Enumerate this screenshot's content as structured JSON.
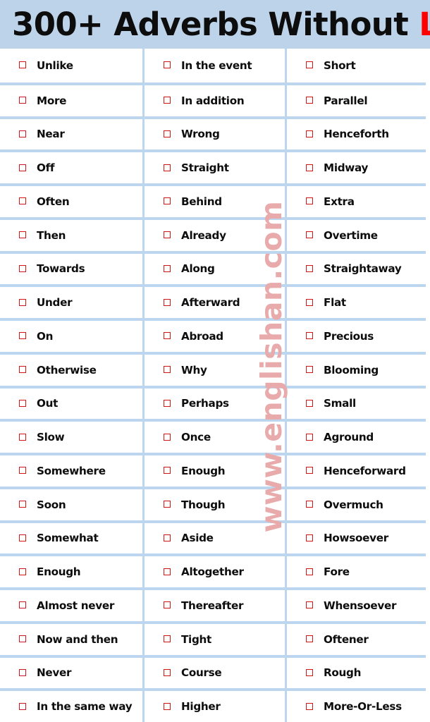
{
  "header": {
    "title_main": "300+ Adverbs Without ",
    "title_accent": "LY",
    "background_color": "#bdd3e9",
    "text_color": "#0d0d0d",
    "accent_color": "#ff0000"
  },
  "watermark": {
    "text": "www.englishan.com",
    "color": "#e8aaaa",
    "rotation": "-90deg"
  },
  "table": {
    "checkbox_icon": "empty-checkbox-icon",
    "checkbox_color": "#cf1717",
    "divider_color": "#bcd6ef",
    "row_count": 20,
    "column_count": 3,
    "columns": [
      {
        "name": "column-1",
        "items": [
          "Unlike",
          "More",
          "Near",
          "Off",
          "Often",
          "Then",
          "Towards",
          "Under",
          "On",
          "Otherwise",
          "Out",
          "Slow",
          "Somewhere",
          "Soon",
          "Somewhat",
          "Enough",
          "Almost never",
          "Now and then",
          "Never",
          "In the same way"
        ]
      },
      {
        "name": "column-2",
        "items": [
          "In the event",
          "In addition",
          "Wrong",
          "Straight",
          "Behind",
          "Already",
          "Along",
          "Afterward",
          "Abroad",
          "Why",
          "Perhaps",
          "Once",
          "Enough",
          "Though",
          "Aside",
          "Altogether",
          "Thereafter",
          "Tight",
          "Course",
          "Higher"
        ]
      },
      {
        "name": "column-3",
        "items": [
          "Short",
          "Parallel",
          "Henceforth",
          "Midway",
          "Extra",
          "Overtime",
          "Straightaway",
          "Flat",
          "Precious",
          "Blooming",
          "Small",
          "Aground",
          "Henceforward",
          "Overmuch",
          "Howsoever",
          "Fore",
          "Whensoever",
          "Oftener",
          "Rough",
          "More-Or-Less"
        ]
      }
    ]
  }
}
